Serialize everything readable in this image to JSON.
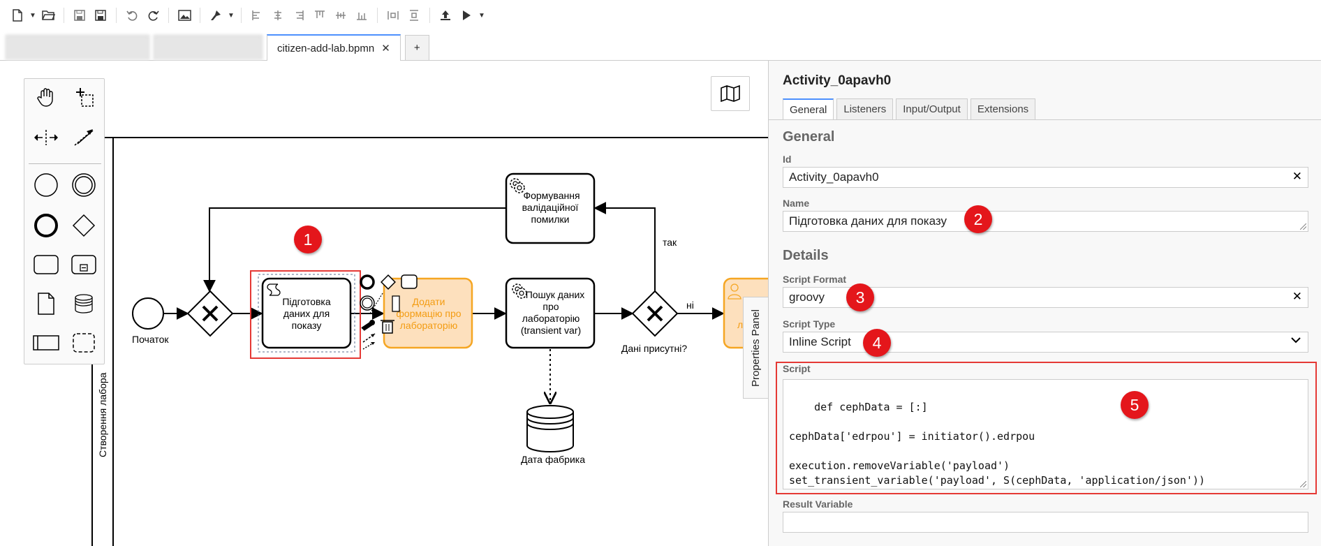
{
  "toolbar": {
    "icons": [
      "new-file-icon",
      "open-folder-icon",
      "save-icon",
      "save-as-icon",
      "undo-icon",
      "redo-icon",
      "image-export-icon",
      "paint-brush-icon",
      "align-left-icon",
      "align-center-icon",
      "align-right-icon",
      "align-top-icon",
      "align-middle-icon",
      "align-bottom-icon",
      "distribute-horizontal-icon",
      "distribute-vertical-icon",
      "deploy-icon",
      "run-icon"
    ]
  },
  "tabs": {
    "active_label": "citizen-add-lab.bpmn",
    "close_glyph": "✕",
    "add_glyph": "+"
  },
  "diagram": {
    "lane_label": "Створення лабора",
    "start_event_label": "Початок",
    "script_task": {
      "label_lines": [
        "Підготовка",
        "даних для",
        "показу"
      ]
    },
    "user_task_add": {
      "label_lines": [
        "Додати",
        "формацію про",
        "лабораторію"
      ]
    },
    "service_task_search": {
      "label_lines": [
        "Пошук даних",
        "про",
        "лабораторію",
        "(transient var)"
      ]
    },
    "service_task_error": {
      "label_lines": [
        "Формування",
        "валідаційної",
        "помилки"
      ]
    },
    "gateway_label": "Дані присутні?",
    "flow_yes": "так",
    "flow_no": "ні",
    "datastore_label": "Дата фабрика",
    "partial_task_text": "л",
    "colors": {
      "user_task_fill": "#fde0bd",
      "user_task_stroke": "#f5a623",
      "user_task_text": "#f39c12",
      "selection": "#e53935"
    }
  },
  "properties_toggle": "Properties Panel",
  "panel": {
    "title": "Activity_0apavh0",
    "tabs": [
      "General",
      "Listeners",
      "Input/Output",
      "Extensions"
    ],
    "active_tab": "General",
    "section_general": "General",
    "id_label": "Id",
    "id_value": "Activity_0apavh0",
    "name_label": "Name",
    "name_value": "Підготовка даних для показу",
    "section_details": "Details",
    "script_format_label": "Script Format",
    "script_format_value": "groovy",
    "script_type_label": "Script Type",
    "script_type_value": "Inline Script",
    "script_label": "Script",
    "script_value": "def cephData = [:]\n\ncephData['edrpou'] = initiator().edrpou\n\nexecution.removeVariable('payload')\nset_transient_variable('payload', S(cephData, 'application/json'))",
    "result_variable_label": "Result Variable",
    "result_variable_value": ""
  },
  "badges": [
    "1",
    "2",
    "3",
    "4",
    "5"
  ]
}
